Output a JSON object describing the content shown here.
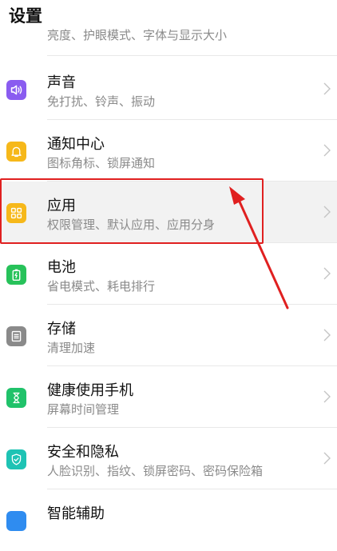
{
  "header": {
    "title": "设置"
  },
  "items": [
    {
      "name": "",
      "desc": "亮度、护眼模式、字体与显示大小",
      "icon": "display-icon",
      "color": "#2fbf5a"
    },
    {
      "name": "声音",
      "desc": "免打扰、铃声、振动",
      "icon": "sound-icon",
      "color": "#8a5cf0"
    },
    {
      "name": "通知中心",
      "desc": "图标角标、锁屏通知",
      "icon": "bell-icon",
      "color": "#f6b81a"
    },
    {
      "name": "应用",
      "desc": "权限管理、默认应用、应用分身",
      "icon": "apps-icon",
      "color": "#f6b81a"
    },
    {
      "name": "电池",
      "desc": "省电模式、耗电排行",
      "icon": "battery-icon",
      "color": "#27c25a"
    },
    {
      "name": "存储",
      "desc": "清理加速",
      "icon": "storage-icon",
      "color": "#8a8a8a"
    },
    {
      "name": "健康使用手机",
      "desc": "屏幕时间管理",
      "icon": "hourglass-icon",
      "color": "#20c26a"
    },
    {
      "name": "安全和隐私",
      "desc": "人脸识别、指纹、锁屏密码、密码保险箱",
      "icon": "shield-icon",
      "color": "#1ec3b4"
    },
    {
      "name": "智能辅助",
      "desc": "",
      "icon": "assist-icon",
      "color": "#2f8cf0"
    }
  ],
  "annotation": {
    "color": "#e02020"
  }
}
